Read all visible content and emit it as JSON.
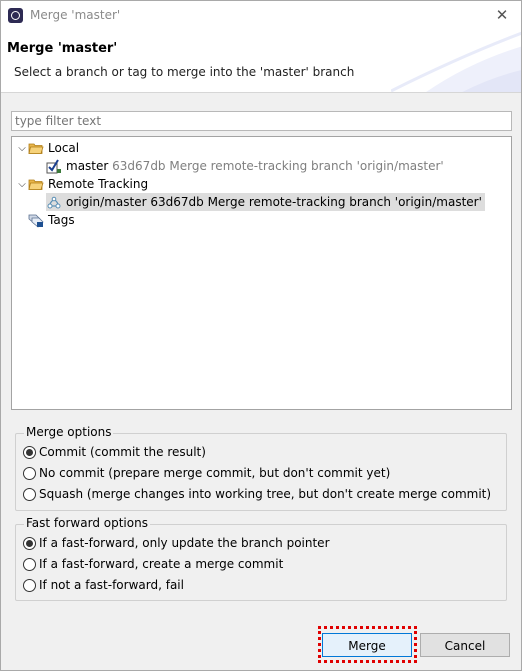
{
  "window": {
    "title": "Merge 'master'",
    "close_glyph": "✕"
  },
  "banner": {
    "title": "Merge 'master'",
    "description": "Select a branch or tag to merge into the 'master' branch"
  },
  "filter": {
    "placeholder": "type filter text",
    "value": ""
  },
  "tree": {
    "local": {
      "label": "Local",
      "children": [
        {
          "name": "master",
          "detail": "63d67db Merge remote-tracking branch 'origin/master'"
        }
      ]
    },
    "remote": {
      "label": "Remote Tracking",
      "children": [
        {
          "name": "origin/master",
          "detail": "63d67db Merge remote-tracking branch 'origin/master'"
        }
      ]
    },
    "tags": {
      "label": "Tags"
    }
  },
  "merge_options": {
    "legend": "Merge options",
    "options": [
      {
        "label": "Commit (commit the result)",
        "checked": true
      },
      {
        "label": "No commit (prepare merge commit, but don't commit yet)",
        "checked": false
      },
      {
        "label": "Squash (merge changes into working tree, but don't create merge commit)",
        "checked": false
      }
    ]
  },
  "ff_options": {
    "legend": "Fast forward options",
    "options": [
      {
        "label": "If a fast-forward, only update the branch pointer",
        "checked": true
      },
      {
        "label": "If a fast-forward, create a merge commit",
        "checked": false
      },
      {
        "label": "If not a fast-forward, fail",
        "checked": false
      }
    ]
  },
  "buttons": {
    "merge": "Merge",
    "cancel": "Cancel"
  },
  "icons": {
    "app": "eclipse-icon",
    "folder": "folder-open-icon",
    "branch_local": "branch-checked-icon",
    "branch_remote": "remote-branch-icon",
    "tags": "tags-icon"
  },
  "colors": {
    "focus_ring": "#e00000",
    "primary_border": "#0078d7",
    "selection": "#dddddd"
  }
}
